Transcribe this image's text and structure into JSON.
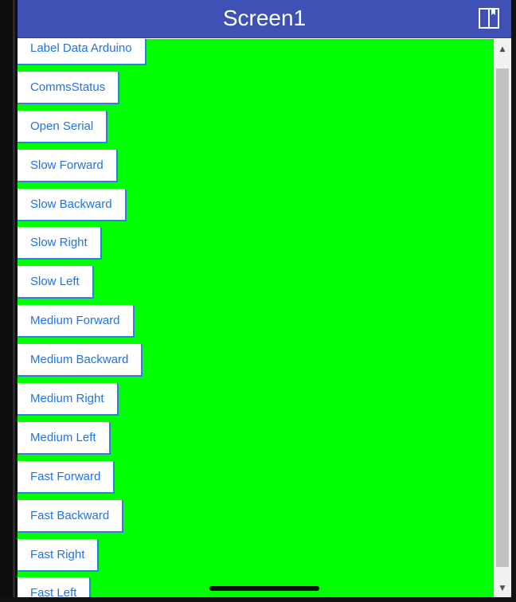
{
  "titlebar": {
    "title": "Screen1",
    "icon": "book-icon"
  },
  "buttons": [
    {
      "label": "Label Data Arduino"
    },
    {
      "label": "CommsStatus"
    },
    {
      "label": "Open Serial"
    },
    {
      "label": "Slow Forward"
    },
    {
      "label": "Slow Backward"
    },
    {
      "label": "Slow Right"
    },
    {
      "label": "Slow Left"
    },
    {
      "label": "Medium Forward"
    },
    {
      "label": "Medium Backward"
    },
    {
      "label": "Medium Right"
    },
    {
      "label": "Medium Left"
    },
    {
      "label": "Fast Forward"
    },
    {
      "label": "Fast Backward"
    },
    {
      "label": "Fast Right"
    },
    {
      "label": "Fast Left"
    }
  ],
  "scrollbar": {
    "up_icon": "scroll-up-arrow-icon",
    "down_icon": "scroll-down-arrow-icon"
  },
  "colors": {
    "titlebar": "#3f51b5",
    "screen_background": "#00ff00",
    "button_text": "#1f73e8"
  }
}
